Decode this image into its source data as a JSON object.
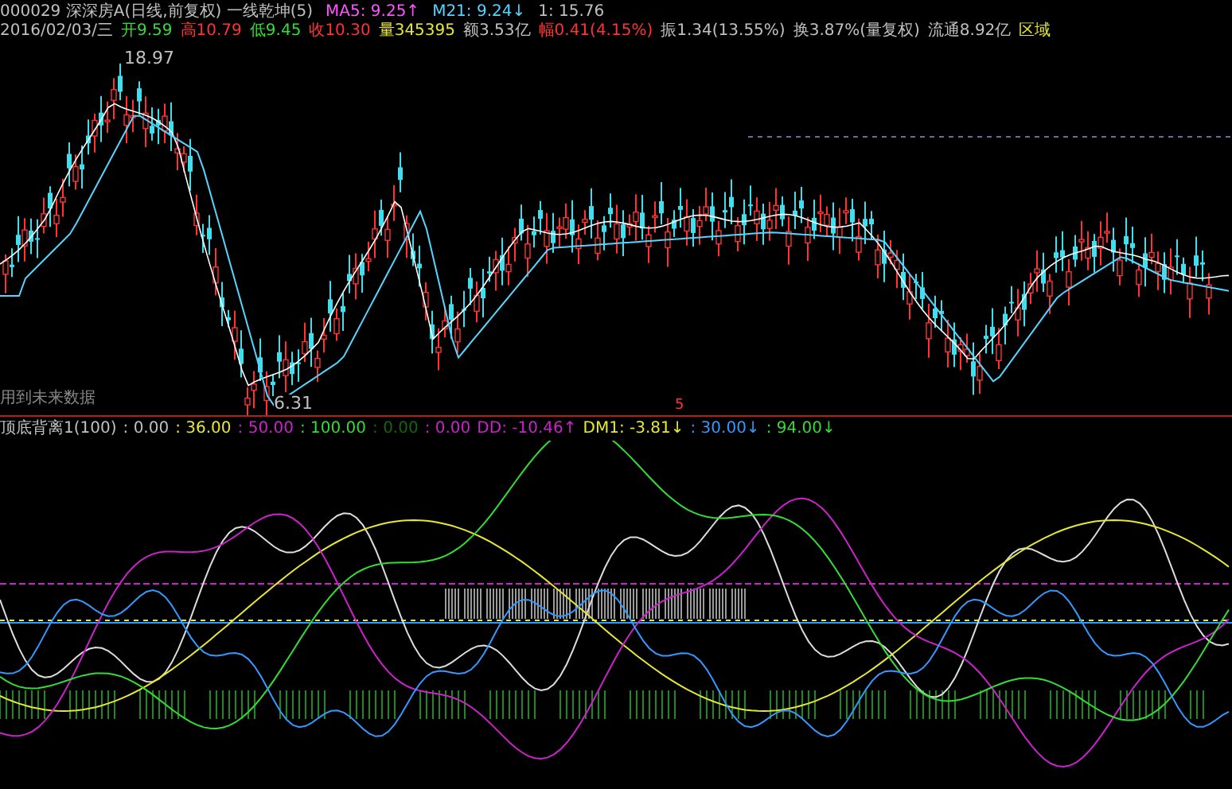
{
  "header": {
    "title_line": [
      {
        "text": "000029 深深房A(日线,前复权) 一线乾坤(5)",
        "color": "#c0c0c0"
      },
      {
        "text": "MA5: 9.25↑",
        "color": "#ff55ff"
      },
      {
        "text": "M21: 9.24↓",
        "color": "#55d5ff"
      },
      {
        "text": "1: 15.76",
        "color": "#c0c0c0"
      }
    ],
    "quote_line": [
      {
        "text": "2016/02/03/三",
        "color": "#c0c0c0"
      },
      {
        "text": "开9.59",
        "color": "#33dd33"
      },
      {
        "text": "高10.79",
        "color": "#ff3333"
      },
      {
        "text": "低9.45",
        "color": "#33dd33"
      },
      {
        "text": "收10.30",
        "color": "#ff3333"
      },
      {
        "text": "量345395",
        "color": "#e8e833"
      },
      {
        "text": "额3.53亿",
        "color": "#c0c0c0"
      },
      {
        "text": "幅0.41(4.15%)",
        "color": "#ff3333"
      },
      {
        "text": "振1.34(13.55%)",
        "color": "#c0c0c0"
      },
      {
        "text": "换3.87%(量复权)",
        "color": "#c0c0c0"
      },
      {
        "text": "流通8.92亿",
        "color": "#c0c0c0"
      },
      {
        "text": "区域",
        "color": "#e8e833"
      }
    ]
  },
  "main_chart": {
    "high_label": "18.97",
    "low_label": "6.31",
    "note": "用到未来数据"
  },
  "indicator": {
    "marker": "5",
    "values": [
      {
        "text": "顶底背离1(100)",
        "color": "#c0c0c0"
      },
      {
        "text": ": 0.00",
        "color": "#c0c0c0"
      },
      {
        "text": ": 36.00",
        "color": "#e8e833"
      },
      {
        "text": ": 50.00",
        "color": "#cc22cc"
      },
      {
        "text": ": 100.00",
        "color": "#33dd33"
      },
      {
        "text": ": 0.00",
        "color": "#116611"
      },
      {
        "text": ": 0.00",
        "color": "#cc22cc"
      },
      {
        "text": "DD: -10.46↑",
        "color": "#cc22cc"
      },
      {
        "text": "DM1: -3.81↓",
        "color": "#e8e833"
      },
      {
        "text": ": 30.00↓",
        "color": "#3399ff"
      },
      {
        "text": ": 94.00↓",
        "color": "#33dd33"
      }
    ]
  }
}
